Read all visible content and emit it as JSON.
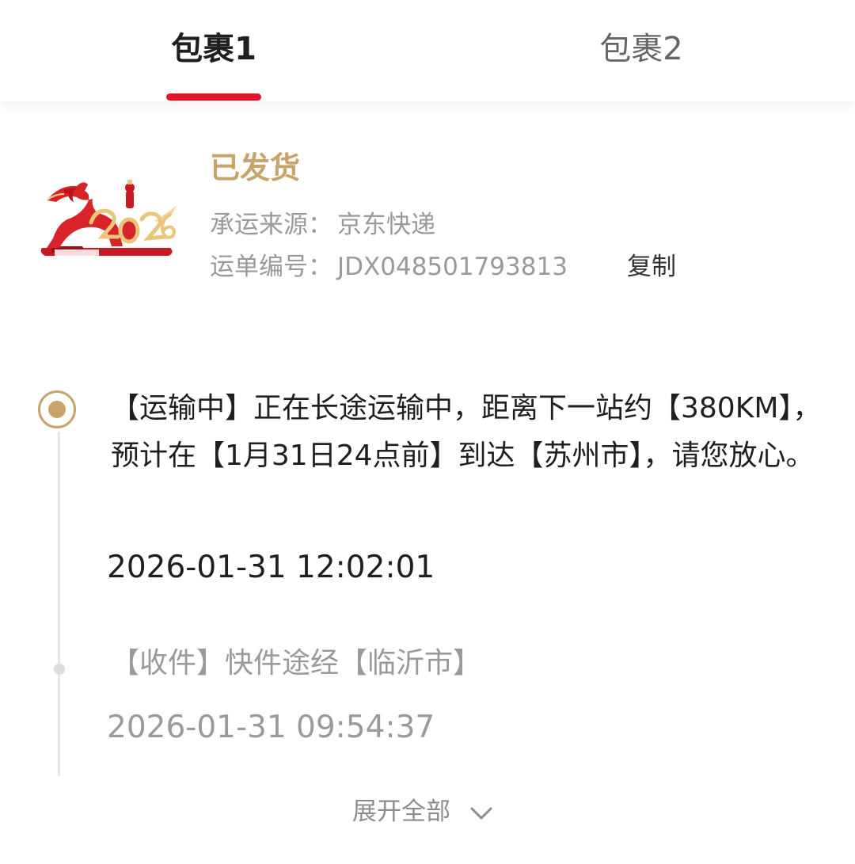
{
  "tabs": [
    {
      "label": "包裹1",
      "active": true
    },
    {
      "label": "包裹2",
      "active": false
    }
  ],
  "accent_color": "#e2152b",
  "status_color": "#c6a46a",
  "package": {
    "status": "已发货",
    "carrier_label": "承运来源：",
    "carrier_value": "京东快递",
    "waybill_label": "运单编号：",
    "waybill_value": "JDX048501793813",
    "copy_label": "复制",
    "image_icon": "horse-2026-product-image"
  },
  "timeline": [
    {
      "text": "【运输中】正在长途运输中，距离下一站约【380KM】，预计在【1月31日24点前】到达【苏州市】，请您放心。",
      "time": "2026-01-31 12:02:01",
      "current": true
    },
    {
      "text": "【收件】快件途经【临沂市】",
      "time": "2026-01-31 09:54:37",
      "current": false
    }
  ],
  "expand_label": "展开全部",
  "expand_icon": "chevron-down-icon"
}
